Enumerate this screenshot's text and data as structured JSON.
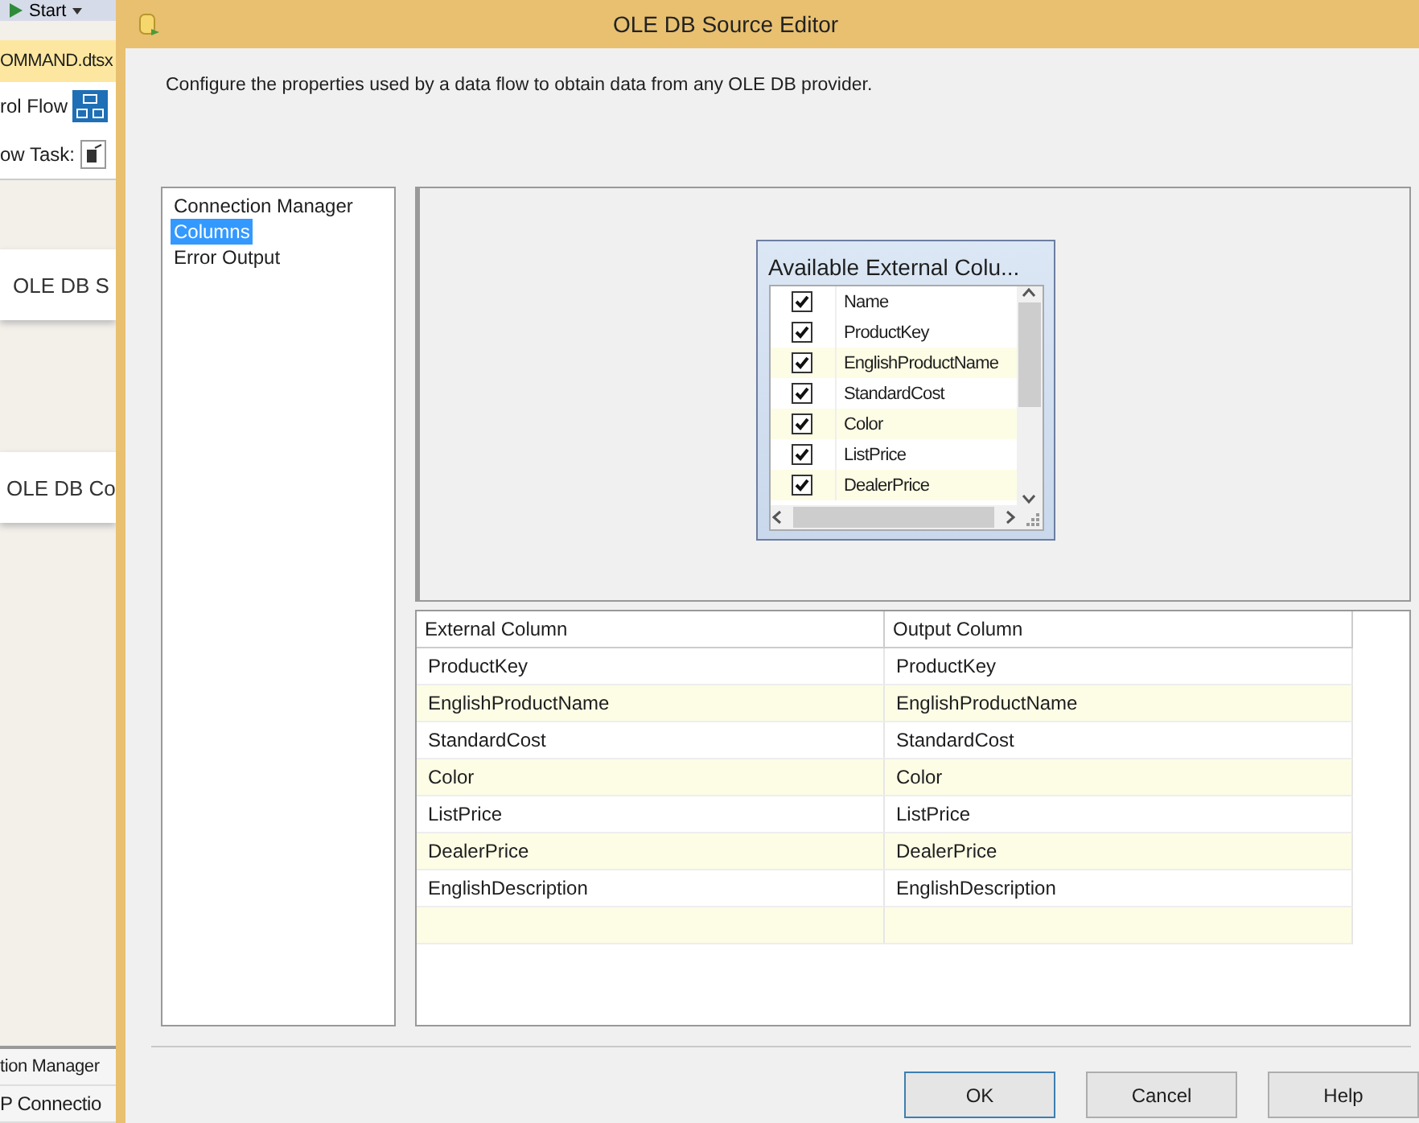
{
  "background": {
    "toolbar_button": "Start",
    "document_tab": "OMMAND.dtsx",
    "designer_tab": "rol Flow",
    "task_label": "ow Task:",
    "nodes": [
      "OLE DB S",
      "OLE DB Co"
    ],
    "bottom_items": [
      "tion Manager",
      "P Connectio"
    ]
  },
  "dialog": {
    "title": "OLE DB Source Editor",
    "description": "Configure the properties used by a data flow to obtain data from any OLE DB provider.",
    "nav": [
      {
        "label": "Connection Manager",
        "selected": false
      },
      {
        "label": "Columns",
        "selected": true
      },
      {
        "label": "Error Output",
        "selected": false
      }
    ],
    "available_columns": {
      "title": "Available External Colu...",
      "header": {
        "label": "Name",
        "checked": true
      },
      "rows": [
        {
          "name": "ProductKey",
          "checked": true
        },
        {
          "name": "EnglishProductName",
          "checked": true
        },
        {
          "name": "StandardCost",
          "checked": true
        },
        {
          "name": "Color",
          "checked": true
        },
        {
          "name": "ListPrice",
          "checked": true
        },
        {
          "name": "DealerPrice",
          "checked": true
        }
      ]
    },
    "mapping": {
      "columns": [
        "External Column",
        "Output Column"
      ],
      "rows": [
        [
          "ProductKey",
          "ProductKey"
        ],
        [
          "EnglishProductName",
          "EnglishProductName"
        ],
        [
          "StandardCost",
          "StandardCost"
        ],
        [
          "Color",
          "Color"
        ],
        [
          "ListPrice",
          "ListPrice"
        ],
        [
          "DealerPrice",
          "DealerPrice"
        ],
        [
          "EnglishDescription",
          "EnglishDescription"
        ]
      ]
    },
    "buttons": [
      "OK",
      "Cancel",
      "Help"
    ]
  }
}
